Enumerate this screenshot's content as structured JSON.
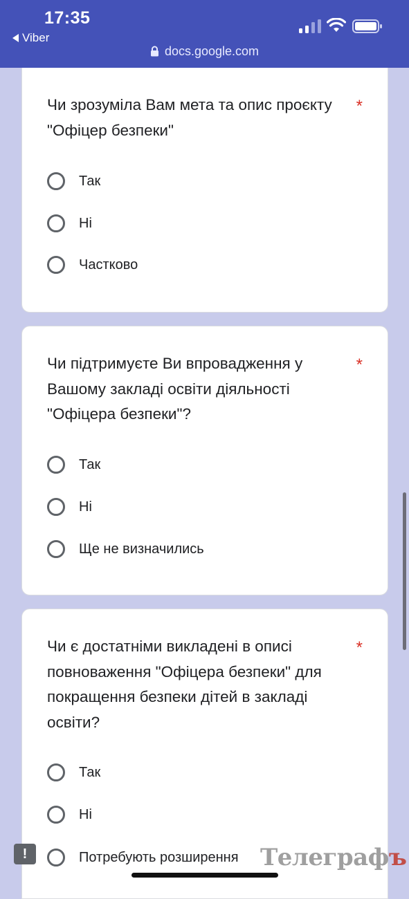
{
  "status_bar": {
    "time": "17:35",
    "back_label": "Viber",
    "url": "docs.google.com"
  },
  "questions": [
    {
      "text": "Чи зрозуміла Вам мета та опис проєкту \"Офіцер безпеки\"",
      "required_mark": "*",
      "options": [
        "Так",
        "Ні",
        "Частково"
      ]
    },
    {
      "text": "Чи підтримуєте Ви впровадження у Вашому закладі освіти діяльності \"Офіцера безпеки\"?",
      "required_mark": "*",
      "options": [
        "Так",
        "Ні",
        "Ще не визначились"
      ]
    },
    {
      "text": "Чи є достатніми викладені в описі повноваження \"Офіцера безпеки\" для покращення безпеки дітей в закладі освіти?",
      "required_mark": "*",
      "options": [
        "Так",
        "Ні",
        "Потребують розширення"
      ]
    }
  ],
  "feedback_icon": "feedback-icon",
  "watermark": {
    "main": "Телеграф",
    "last": "ъ"
  },
  "colors": {
    "header": "#4452b8",
    "background": "#c8cbeb",
    "required": "#d93025",
    "radio": "#5f6368"
  }
}
